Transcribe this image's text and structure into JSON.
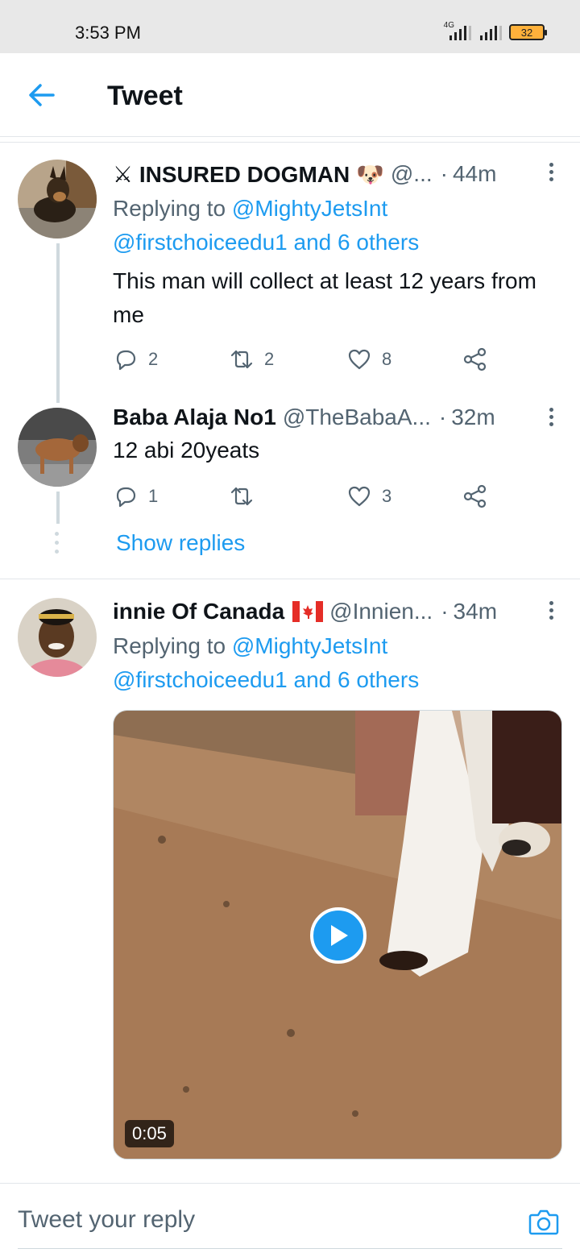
{
  "status_bar": {
    "time": "3:53 PM",
    "network": "4G",
    "battery": "32",
    "icons": [
      "signal-icon",
      "signal-icon",
      "battery-icon"
    ]
  },
  "header": {
    "title": "Tweet",
    "back_icon": "arrow-left-icon"
  },
  "tweets": [
    {
      "name": "⚔ INSURED DOGMAN 🐶",
      "handle": "@...",
      "separator": "·",
      "age": "44m",
      "replying_prefix": "Replying to",
      "replying_main": "@MightyJetsInt",
      "replying_rest": "@firstchoiceedu1 and 6 others",
      "text": "This man will collect at least 12 years from me",
      "replies": "2",
      "retweets": "2",
      "likes": "8"
    },
    {
      "name": "Baba Alaja No1",
      "handle": "@TheBabaA...",
      "separator": "·",
      "age": "32m",
      "text": "12 abi 20yeats",
      "replies": "1",
      "retweets": "",
      "likes": "3",
      "show_replies": "Show replies"
    },
    {
      "name": "innie Of Canada",
      "flag_icon": "canada-flag-icon",
      "handle": "@Innien...",
      "separator": "·",
      "age": "34m",
      "replying_prefix": "Replying to",
      "replying_main": "@MightyJetsInt",
      "replying_rest": "@firstchoiceedu1 and 6 others",
      "video_duration": "0:05",
      "video_icon": "play-icon"
    }
  ],
  "reply_bar": {
    "placeholder": "Tweet your reply",
    "camera_icon": "camera-icon"
  },
  "colors": {
    "accent": "#1d9bf0",
    "text": "#0f1419",
    "muted": "#536471",
    "divider": "#e2e6ea"
  }
}
